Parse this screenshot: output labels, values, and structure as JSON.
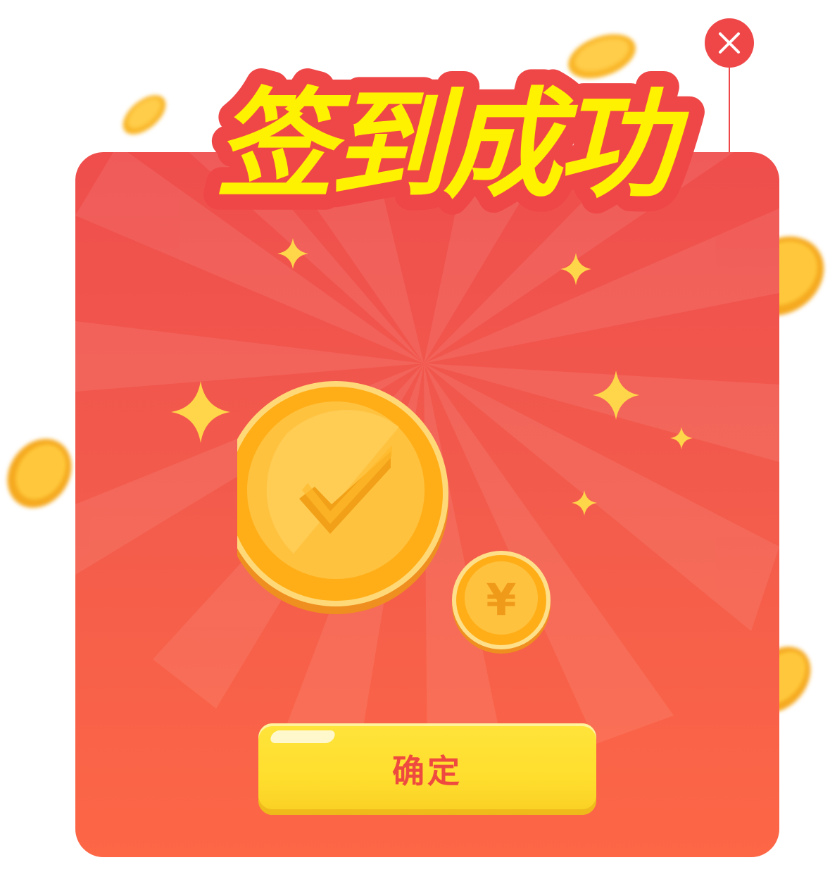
{
  "dialog": {
    "title": "签到成功",
    "confirm_label": "确定",
    "close_icon": "close-icon",
    "coin_symbol": "¥",
    "badge_icon": "checkmark-icon"
  },
  "colors": {
    "card_red": "#ef4e4c",
    "card_orange": "#fd6746",
    "title_yellow": "#fff200",
    "title_outline": "#ef4748",
    "coin_gold": "#ffb21a",
    "button_yellow": "#ffe03a",
    "button_text": "#ee4a3f"
  }
}
